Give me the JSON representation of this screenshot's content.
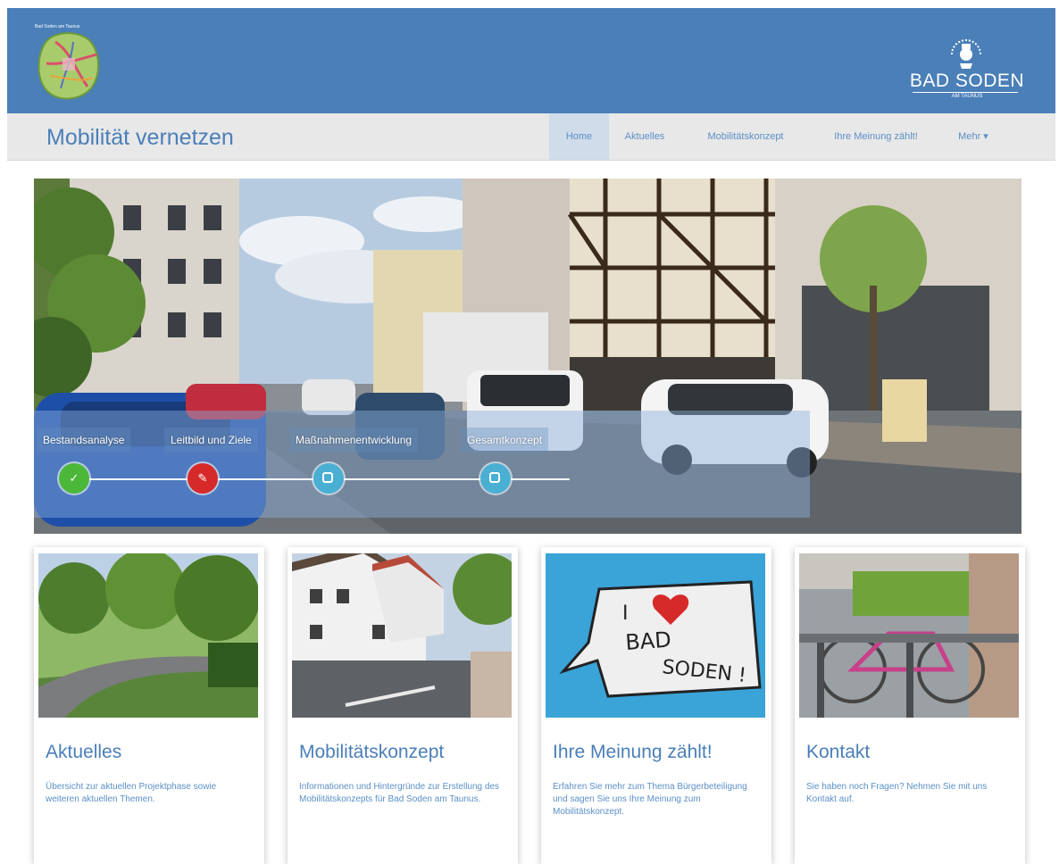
{
  "header": {
    "logo_caption": "Bad Soden am Taunus",
    "city_name": "BAD SODEN",
    "city_sub": "AM TAUNUS"
  },
  "navbar": {
    "brand": "Mobilität vernetzen",
    "items": [
      {
        "label": "Home",
        "active": true
      },
      {
        "label": "Aktuelles"
      },
      {
        "label": "Mobilitätskonzept"
      },
      {
        "label": "Ihre Meinung zählt!"
      },
      {
        "label": "Mehr ▾"
      }
    ]
  },
  "hero": {
    "steps": [
      {
        "label": "Bestandsanalyse",
        "status": "done",
        "color": "#4cb83a"
      },
      {
        "label": "Leitbild und Ziele",
        "status": "current",
        "color": "#d62a2a"
      },
      {
        "label": "Maßnahmenentwicklung",
        "status": "open",
        "color": "#49b0d4"
      },
      {
        "label": "Gesamtkonzept",
        "status": "open",
        "color": "#49b0d4"
      }
    ]
  },
  "cards": [
    {
      "title": "Aktuelles",
      "text": "Übersicht zur aktuellen Projektphase sowie weiteren aktuellen Themen."
    },
    {
      "title": "Mobilitätskonzept",
      "text": "Informationen und Hintergründe zur Erstellung des Mobilitätskonzepts für Bad Soden am Taunus."
    },
    {
      "title": "Ihre Meinung zählt!",
      "text": "Erfahren Sie mehr zum Thema Bürgerbeteiligung und sagen Sie uns Ihre Meinung zum Mobilitätskonzept."
    },
    {
      "title": "Kontakt",
      "text": "Sie haben noch Fragen? Nehmen Sie mit uns Kontakt auf."
    }
  ],
  "graffiti": {
    "line1": "I",
    "line2": "BAD",
    "line3": "SODEN !"
  },
  "colors": {
    "header": "#4a7fb8",
    "accent": "#5b8fc7"
  }
}
